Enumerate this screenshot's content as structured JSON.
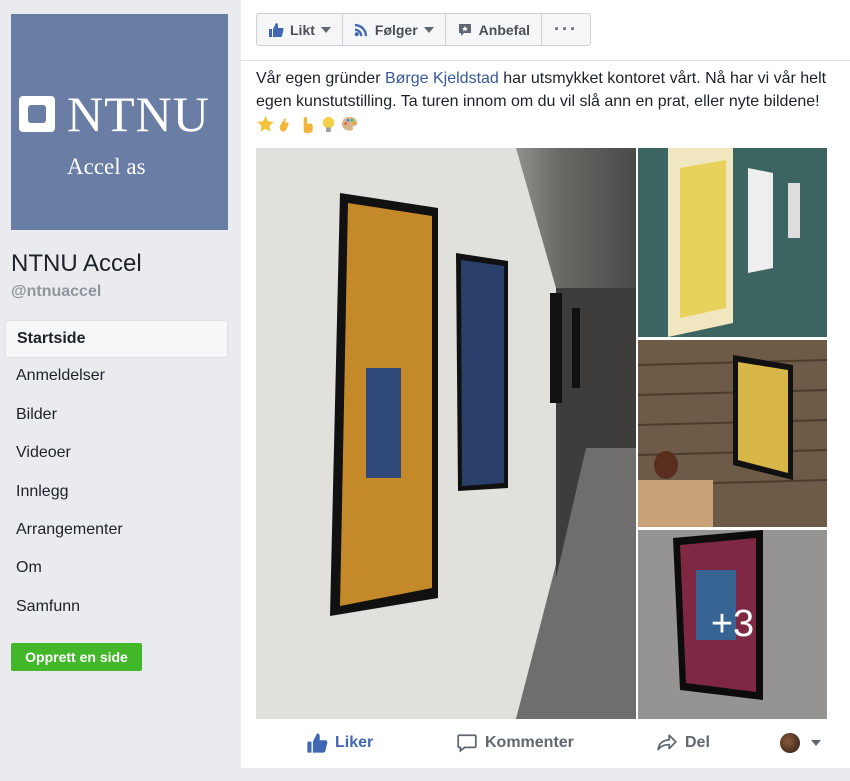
{
  "page": {
    "logo_text": "NTNU",
    "logo_subtitle": "Accel as",
    "name": "NTNU Accel",
    "handle": "@ntnuaccel"
  },
  "nav": {
    "items": [
      {
        "label": "Startside",
        "active": true
      },
      {
        "label": "Anmeldelser"
      },
      {
        "label": "Bilder"
      },
      {
        "label": "Videoer"
      },
      {
        "label": "Innlegg"
      },
      {
        "label": "Arrangementer"
      },
      {
        "label": "Om"
      },
      {
        "label": "Samfunn"
      }
    ],
    "create_page_label": "Opprett en side"
  },
  "toolbar": {
    "liked_label": "Likt",
    "follow_label": "Følger",
    "recommend_label": "Anbefal",
    "more_label": "···"
  },
  "post": {
    "text_before": "Vår egen gründer ",
    "mention": "Børge Kjeldstad",
    "text_after": " har utsmykket kontoret vårt. Nå har vi vår helt egen kunstutstilling. Ta turen innom om du vil slå ann en prat, eller nyte bildene!",
    "emojis": [
      "star",
      "call-me-hand",
      "pointing-up",
      "light-bulb",
      "palette"
    ],
    "more_photos_label": "+3"
  },
  "actions": {
    "like_label": "Liker",
    "comment_label": "Kommenter",
    "share_label": "Del"
  },
  "colors": {
    "brand_blue": "#4267b2",
    "link_blue": "#365899",
    "green": "#42b72a",
    "logo_bg": "#6a7ea5"
  }
}
